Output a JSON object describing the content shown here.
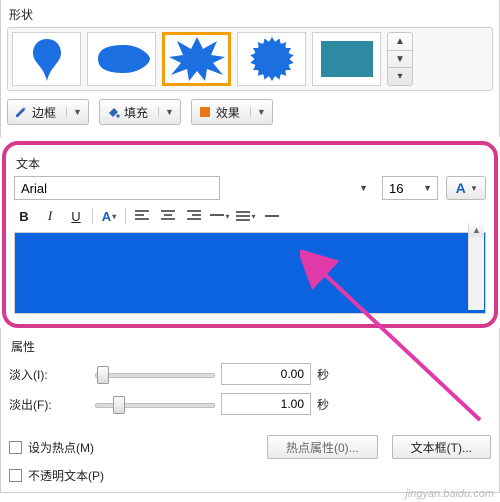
{
  "shapes": {
    "label": "形状",
    "items": [
      "balloon-pin",
      "teardrop",
      "burst",
      "seal",
      "rect"
    ],
    "selected_index": 2
  },
  "style_buttons": {
    "border": "边框",
    "fill": "填充",
    "effect": "效果"
  },
  "text": {
    "label": "文本",
    "font_name": "Arial",
    "font_size": "16",
    "preview_bg": "#0b63e0"
  },
  "attributes": {
    "label": "属性",
    "fade_in_label": "淡入(I):",
    "fade_in_value": "0.00",
    "fade_out_label": "淡出(F):",
    "fade_out_value": "1.00",
    "seconds_suffix": "秒"
  },
  "options": {
    "hotspot_checkbox": "设为热点(M)",
    "hotspot_button": "热点属性(0)...",
    "textbox_button": "文本框(T)...",
    "opaque_checkbox": "不透明文本(P)"
  },
  "watermark": "jingyan.baidu.com"
}
